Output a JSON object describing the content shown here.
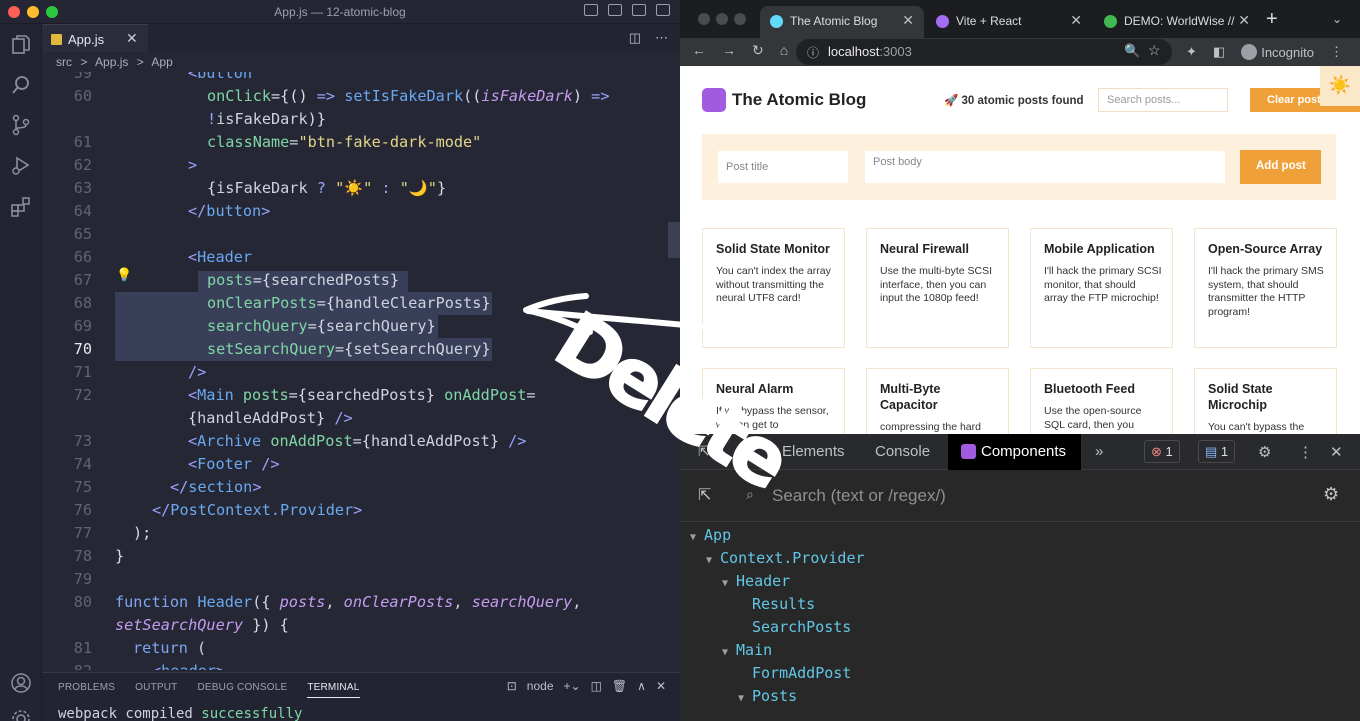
{
  "vscode": {
    "window_title": "App.js — 12-atomic-blog",
    "tab_label": "App.js",
    "breadcrumb": [
      "src",
      ">",
      "App.js",
      ">",
      "App"
    ],
    "panel_tabs": [
      "PROBLEMS",
      "OUTPUT",
      "DEBUG CONSOLE",
      "TERMINAL"
    ],
    "terminal_name": "node",
    "terminal_out_1": "webpack compiled ",
    "terminal_out_2": "successfully"
  },
  "code": {
    "line_numbers": [
      "59",
      "60",
      "",
      "61",
      "62",
      "63",
      "64",
      "65",
      "66",
      "67",
      "68",
      "69",
      "70",
      "71",
      "72",
      "",
      "73",
      "74",
      "75",
      "76",
      "77",
      "78",
      "79",
      "80",
      "",
      "81",
      "82"
    ]
  },
  "browser": {
    "tabs": [
      {
        "label": "The Atomic Blog",
        "close": "✕"
      },
      {
        "label": "Vite + React",
        "close": "✕"
      },
      {
        "label": "DEMO: WorldWise // Ke",
        "close": "✕"
      }
    ],
    "new_tab": "+",
    "url_host": "localhost",
    "url_port": ":3003",
    "incognito": "Incognito"
  },
  "blog": {
    "title": "The Atomic Blog",
    "results": "🚀 30 atomic posts found",
    "search_placeholder": "Search posts...",
    "clear_button": "Clear posts",
    "theme_toggle": "☀️",
    "post_title_placeholder": "Post title",
    "post_body_placeholder": "Post body",
    "add_button": "Add post",
    "cards": [
      {
        "title": "Solid State Monitor",
        "body": "You can't index the array without transmitting the neural UTF8 card!"
      },
      {
        "title": "Neural Firewall",
        "body": "Use the multi-byte SCSI interface, then you can input the 1080p feed!"
      },
      {
        "title": "Mobile Application",
        "body": "I'll hack the primary SCSI monitor, that should array the FTP microchip!"
      },
      {
        "title": "Open-Source Array",
        "body": "I'll hack the primary SMS system, that should transmitter the HTTP program!"
      },
      {
        "title": "Neural Alarm",
        "body": "If we bypass the sensor, we can get to"
      },
      {
        "title": "Multi-Byte Capacitor",
        "body": "compressing the hard"
      },
      {
        "title": "Bluetooth Feed",
        "body": "Use the open-source SQL card, then you"
      },
      {
        "title": "Solid State Microchip",
        "body": "You can't bypass the"
      }
    ]
  },
  "devtools": {
    "tabs": [
      "Elements",
      "Console",
      "Components",
      "»"
    ],
    "errors": "1",
    "messages": "1",
    "search_placeholder": "Search (text or /regex/)",
    "tree": [
      {
        "label": "App",
        "expanded": true
      },
      {
        "label": "Context.Provider",
        "expanded": true
      },
      {
        "label": "Header",
        "expanded": true
      },
      {
        "label": "Results",
        "expanded": false
      },
      {
        "label": "SearchPosts",
        "expanded": false
      },
      {
        "label": "Main",
        "expanded": true
      },
      {
        "label": "FormAddPost",
        "expanded": false
      },
      {
        "label": "Posts",
        "expanded": true
      }
    ]
  },
  "annotation": {
    "text": "Delete",
    "color": "#ffffff"
  },
  "colors": {
    "accent": "#f0a038",
    "react": "#a05be0"
  }
}
